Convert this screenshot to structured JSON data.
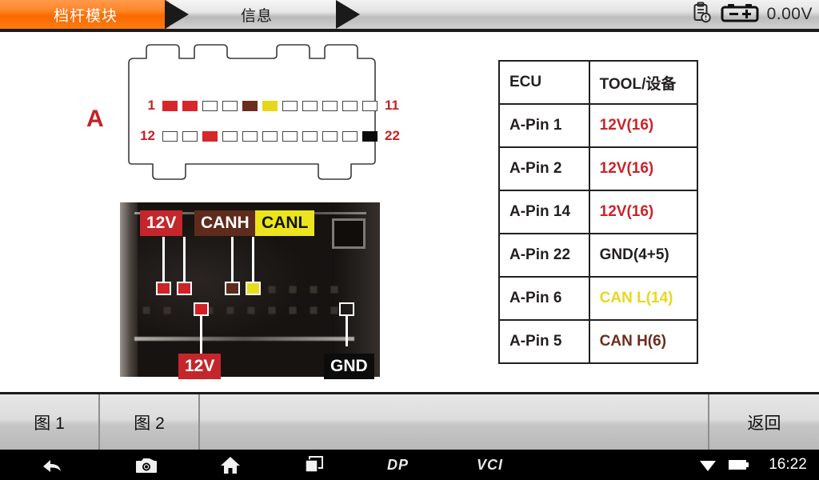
{
  "header": {
    "tabs": [
      {
        "label": "档杆模块",
        "active": true
      },
      {
        "label": "信息",
        "active": false
      }
    ],
    "status": {
      "report_icon": "clipboard-clock-icon",
      "battery_icon": "battery-icon",
      "voltage": "0.00V"
    }
  },
  "diagram": {
    "connector_label": "A",
    "row1": {
      "start_num": "1",
      "end_num": "11",
      "pins": [
        "red",
        "red",
        "white",
        "white",
        "brown",
        "yellow",
        "white",
        "white",
        "white",
        "white",
        "white"
      ]
    },
    "row2": {
      "start_num": "12",
      "end_num": "22",
      "pins": [
        "white",
        "white",
        "red",
        "white",
        "white",
        "white",
        "white",
        "white",
        "white",
        "white",
        "black"
      ]
    }
  },
  "photo": {
    "callouts": [
      {
        "label": "12V",
        "color": "red",
        "position": "top"
      },
      {
        "label": "CANH",
        "color": "brown",
        "position": "top"
      },
      {
        "label": "CANL",
        "color": "yellow",
        "position": "top"
      },
      {
        "label": "12V",
        "color": "red",
        "position": "bottom"
      },
      {
        "label": "GND",
        "color": "black",
        "position": "bottom"
      }
    ]
  },
  "table": {
    "headers": [
      "ECU",
      "TOOL/设备"
    ],
    "rows": [
      {
        "ecu": "A-Pin 1",
        "tool": "12V(16)",
        "tool_color": "red"
      },
      {
        "ecu": "A-Pin 2",
        "tool": "12V(16)",
        "tool_color": "red"
      },
      {
        "ecu": "A-Pin 14",
        "tool": "12V(16)",
        "tool_color": "red"
      },
      {
        "ecu": "A-Pin 22",
        "tool": "GND(4+5)",
        "tool_color": "black"
      },
      {
        "ecu": "A-Pin 6",
        "tool": "CAN L(14)",
        "tool_color": "yellow"
      },
      {
        "ecu": "A-Pin 5",
        "tool": "CAN H(6)",
        "tool_color": "brown"
      }
    ]
  },
  "footer": {
    "buttons": [
      {
        "label": "图 1"
      },
      {
        "label": "图 2"
      },
      {
        "label": "返回"
      }
    ]
  },
  "navbar": {
    "back_icon": "back-arrow-icon",
    "camera_icon": "camera-icon",
    "home_icon": "home-icon",
    "recents_icon": "recent-apps-icon",
    "dp_logo": "DP",
    "vci_label": "VCI",
    "wifi_icon": "wifi-icon",
    "battery_icon": "battery-icon",
    "time": "16:22"
  },
  "colors": {
    "accent": "#fa6a00",
    "red": "#cc2229",
    "yellow": "#e8d81c",
    "brown": "#6b2d1d",
    "black": "#231f20"
  }
}
